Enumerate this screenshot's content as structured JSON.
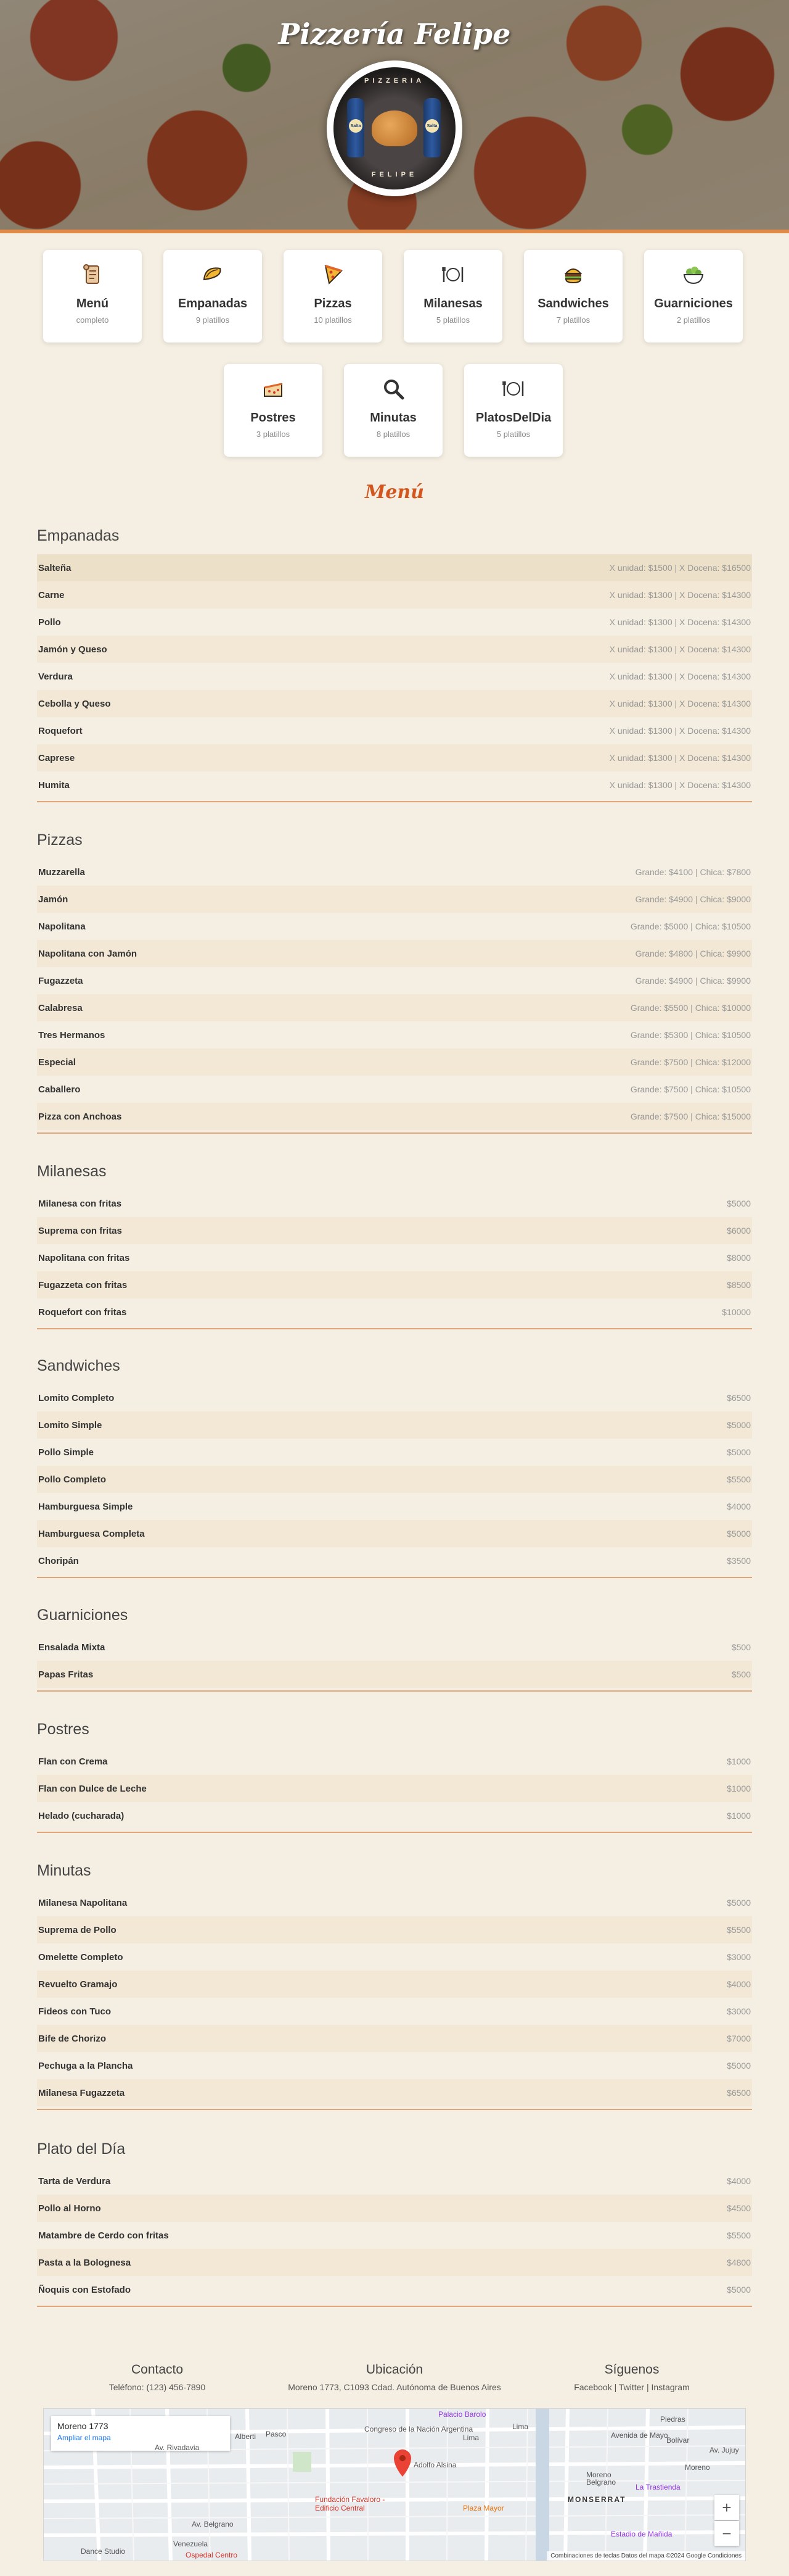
{
  "hero": {
    "title": "Pizzería Felipe",
    "logo_top_text": "PIZZERIA",
    "logo_bottom_text": "FELIPE",
    "logo_bottle_label": "Salta"
  },
  "categories": [
    {
      "name": "Menú",
      "count": "completo",
      "icon": "scroll-icon"
    },
    {
      "name": "Empanadas",
      "count": "9 platillos",
      "icon": "empanada-icon"
    },
    {
      "name": "Pizzas",
      "count": "10 platillos",
      "icon": "pizza-slice-icon"
    },
    {
      "name": "Milanesas",
      "count": "5 platillos",
      "icon": "plate-cutlery-icon"
    },
    {
      "name": "Sandwiches",
      "count": "7 platillos",
      "icon": "burger-icon"
    },
    {
      "name": "Guarniciones",
      "count": "2 platillos",
      "icon": "salad-bowl-icon"
    },
    {
      "name": "Postres",
      "count": "3 platillos",
      "icon": "cake-icon"
    },
    {
      "name": "Minutas",
      "count": "8 platillos",
      "icon": "magnifier-icon"
    },
    {
      "name": "PlatosDelDia",
      "count": "5 platillos",
      "icon": "plate-cutlery-icon"
    }
  ],
  "menu_heading": "Menú",
  "sections": [
    {
      "title": "Empanadas",
      "items": [
        {
          "name": "Salteña",
          "price": "X unidad: $1500 | X Docena: $16500"
        },
        {
          "name": "Carne",
          "price": "X unidad: $1300 | X Docena: $14300"
        },
        {
          "name": "Pollo",
          "price": "X unidad: $1300 | X Docena: $14300"
        },
        {
          "name": "Jamón y Queso",
          "price": "X unidad: $1300 | X Docena: $14300"
        },
        {
          "name": "Verdura",
          "price": "X unidad: $1300 | X Docena: $14300"
        },
        {
          "name": "Cebolla y Queso",
          "price": "X unidad: $1300 | X Docena: $14300"
        },
        {
          "name": "Roquefort",
          "price": "X unidad: $1300 | X Docena: $14300"
        },
        {
          "name": "Caprese",
          "price": "X unidad: $1300 | X Docena: $14300"
        },
        {
          "name": "Humita",
          "price": "X unidad: $1300 | X Docena: $14300"
        }
      ]
    },
    {
      "title": "Pizzas",
      "items": [
        {
          "name": "Muzzarella",
          "price": "Grande: $4100 | Chica: $7800"
        },
        {
          "name": "Jamón",
          "price": "Grande: $4900 | Chica: $9000"
        },
        {
          "name": "Napolitana",
          "price": "Grande: $5000 | Chica: $10500"
        },
        {
          "name": "Napolitana con Jamón",
          "price": "Grande: $4800 | Chica: $9900"
        },
        {
          "name": "Fugazzeta",
          "price": "Grande: $4900 | Chica: $9900"
        },
        {
          "name": "Calabresa",
          "price": "Grande: $5500 | Chica: $10000"
        },
        {
          "name": "Tres Hermanos",
          "price": "Grande: $5300 | Chica: $10500"
        },
        {
          "name": "Especial",
          "price": "Grande: $7500 | Chica: $12000"
        },
        {
          "name": "Caballero",
          "price": "Grande: $7500 | Chica: $10500"
        },
        {
          "name": "Pizza con Anchoas",
          "price": "Grande: $7500 | Chica: $15000"
        }
      ]
    },
    {
      "title": "Milanesas",
      "items": [
        {
          "name": "Milanesa con fritas",
          "price": "$5000"
        },
        {
          "name": "Suprema con fritas",
          "price": "$6000"
        },
        {
          "name": "Napolitana con fritas",
          "price": "$8000"
        },
        {
          "name": "Fugazzeta con fritas",
          "price": "$8500"
        },
        {
          "name": "Roquefort con fritas",
          "price": "$10000"
        }
      ]
    },
    {
      "title": "Sandwiches",
      "items": [
        {
          "name": "Lomito Completo",
          "price": "$6500"
        },
        {
          "name": "Lomito Simple",
          "price": "$5000"
        },
        {
          "name": "Pollo Simple",
          "price": "$5000"
        },
        {
          "name": "Pollo Completo",
          "price": "$5500"
        },
        {
          "name": "Hamburguesa Simple",
          "price": "$4000"
        },
        {
          "name": "Hamburguesa Completa",
          "price": "$5000"
        },
        {
          "name": "Choripán",
          "price": "$3500"
        }
      ]
    },
    {
      "title": "Guarniciones",
      "items": [
        {
          "name": "Ensalada Mixta",
          "price": "$500"
        },
        {
          "name": "Papas Fritas",
          "price": "$500"
        }
      ]
    },
    {
      "title": "Postres",
      "items": [
        {
          "name": "Flan con Crema",
          "price": "$1000"
        },
        {
          "name": "Flan con Dulce de Leche",
          "price": "$1000"
        },
        {
          "name": "Helado (cucharada)",
          "price": "$1000"
        }
      ]
    },
    {
      "title": "Minutas",
      "items": [
        {
          "name": "Milanesa Napolitana",
          "price": "$5000"
        },
        {
          "name": "Suprema de Pollo",
          "price": "$5500"
        },
        {
          "name": "Omelette Completo",
          "price": "$3000"
        },
        {
          "name": "Revuelto Gramajo",
          "price": "$4000"
        },
        {
          "name": "Fideos con Tuco",
          "price": "$3000"
        },
        {
          "name": "Bife de Chorizo",
          "price": "$7000"
        },
        {
          "name": "Pechuga a la Plancha",
          "price": "$5000"
        },
        {
          "name": "Milanesa Fugazzeta",
          "price": "$6500"
        }
      ]
    },
    {
      "title": "Plato del Día",
      "items": [
        {
          "name": "Tarta de Verdura",
          "price": "$4000"
        },
        {
          "name": "Pollo al Horno",
          "price": "$4500"
        },
        {
          "name": "Matambre de Cerdo con fritas",
          "price": "$5500"
        },
        {
          "name": "Pasta a la Bolognesa",
          "price": "$4800"
        },
        {
          "name": "Ñoquis con Estofado",
          "price": "$5000"
        }
      ]
    }
  ],
  "footer": {
    "contact_title": "Contacto",
    "contact_text": "Teléfono: (123) 456-7890",
    "location_title": "Ubicación",
    "location_text": "Moreno 1773, C1093 Cdad. Autónoma de Buenos Aires",
    "social_title": "Síguenos",
    "social_text": "Facebook | Twitter | Instagram"
  },
  "map": {
    "card_address": "Moreno 1773",
    "card_link": "Ampliar el mapa",
    "labels": [
      "Palacio Barolo",
      "Congreso de la Nación Argentina",
      "Lima",
      "Piedras",
      "Avenida de Mayo",
      "Bolívar",
      "Alberti",
      "Pasco",
      "Av. Rivadavia",
      "Adolfo Alsina",
      "Moreno",
      "MONSERRAT",
      "Belgrano",
      "La Trastienda",
      "Av. Belgrano",
      "Venezuela",
      "Fundación Favaloro - Edificio Central",
      "Plaza Mayor",
      "Estadio de Mañida",
      "Ospedal Centro",
      "Dance Studio",
      "Av. Jujuy",
      "Moreno",
      "Lima"
    ],
    "attribution": "Combinaciones de teclas   Datos del mapa ©2024 Google   Condiciones",
    "zoom_in": "+",
    "zoom_out": "−"
  }
}
